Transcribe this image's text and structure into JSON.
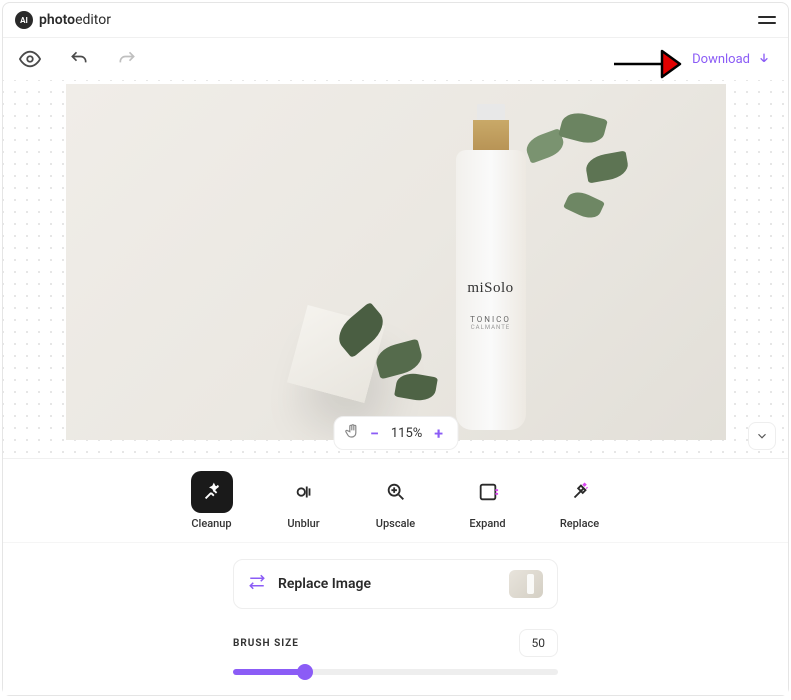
{
  "logo": {
    "badge": "AI",
    "text_bold": "photo",
    "text_light": "editor"
  },
  "toolbar": {
    "download_label": "Download"
  },
  "canvas": {
    "zoom_level": "115%",
    "product": {
      "brand": "miSolo",
      "type": "TONICO",
      "subtype": "CALMANTE"
    }
  },
  "tools": {
    "cleanup": "Cleanup",
    "unblur": "Unblur",
    "upscale": "Upscale",
    "expand": "Expand",
    "replace": "Replace"
  },
  "panel": {
    "replace_image_label": "Replace Image",
    "brush_size_label": "BRUSH SIZE",
    "brush_size_value": "50"
  }
}
